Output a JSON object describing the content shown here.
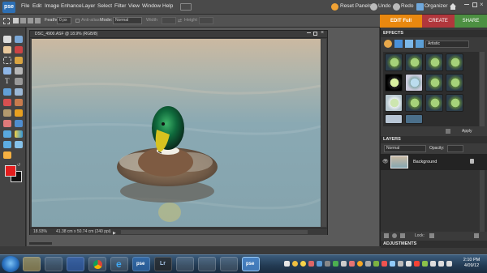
{
  "app": {
    "logo": "pse"
  },
  "menubar": {
    "items": [
      "File",
      "Edit",
      "Image",
      "Enhance",
      "Layer",
      "Select",
      "Filter",
      "View",
      "Window",
      "Help"
    ],
    "reset_panels": "Reset Panels",
    "undo": "Undo",
    "redo": "Redo",
    "organizer": "Organizer"
  },
  "options": {
    "feather_label": "Feather:",
    "feather_value": "0 px",
    "antialias_label": "Anti-alias",
    "mode_label": "Mode:",
    "mode_value": "Normal",
    "width_label": "Width",
    "height_label": "Height"
  },
  "mode_tabs": {
    "edit": "EDIT Full",
    "create": "CREATE",
    "share": "SHARE"
  },
  "document": {
    "title": "DSC_4900.ASF @ 18.9% (RGB/8)",
    "zoom": "18.93%",
    "info": "41.38 cm x 50.74 cm (240 ppi)"
  },
  "effects": {
    "title": "EFFECTS",
    "filter_dropdown": "Artistic",
    "apply_button": "Apply"
  },
  "layers": {
    "title": "LAYERS",
    "blend_mode": "Normal",
    "opacity_label": "Opacity:",
    "layer_name": "Background",
    "lock_label": "Lock:"
  },
  "adjustments": {
    "title": "ADJUSTMENTS"
  },
  "taskbar": {
    "time": "2:10 PM",
    "date": "4/09/12",
    "pse_label": "pse",
    "lr_label": "Lr"
  },
  "colors": {
    "edit_tab": "#e9880f",
    "create_tab": "#b1373c",
    "share_tab": "#4d9042",
    "foreground": "#e41e1e",
    "background": "#111111"
  }
}
